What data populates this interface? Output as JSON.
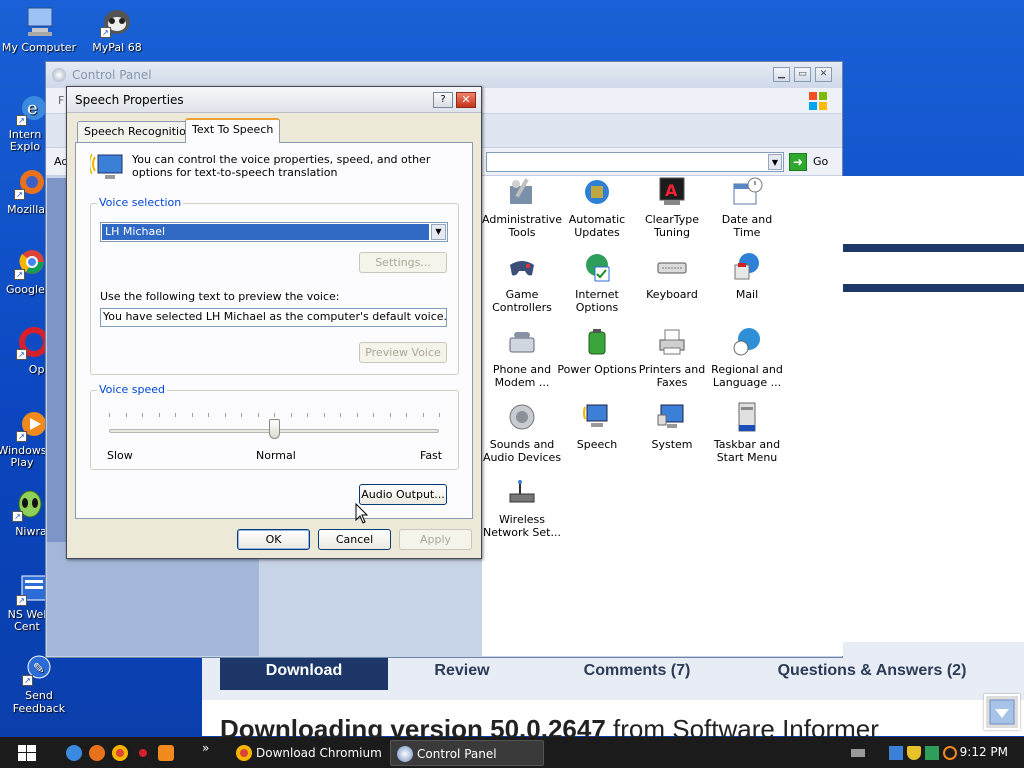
{
  "desktop": {
    "icons": [
      {
        "label": "My Computer"
      },
      {
        "label": "MyPal 68"
      },
      {
        "label": "Intern Explo"
      },
      {
        "label": "Mozilla F"
      },
      {
        "label": "Google C"
      },
      {
        "label": "Ope"
      },
      {
        "label": "Windows Play"
      },
      {
        "label": "Niwrac"
      },
      {
        "label": "NS Wel Cent"
      },
      {
        "label": "Send Feedback"
      }
    ]
  },
  "browser_page": {
    "tabs": [
      "Download",
      "Review",
      "Comments (7)",
      "Questions & Answers (2)"
    ],
    "heading_bold": "Downloading version 50.0.2647",
    "heading_rest": " from Software Informer"
  },
  "control_panel": {
    "title": "Control Panel",
    "left_letters": {
      "f": "F",
      "ad": "Ad"
    },
    "go_label": "Go",
    "items": [
      {
        "label": "Administrative Tools"
      },
      {
        "label": "Automatic Updates"
      },
      {
        "label": "ClearType Tuning"
      },
      {
        "label": "Date and Time"
      },
      {
        "label": "Game Controllers"
      },
      {
        "label": "Internet Options"
      },
      {
        "label": "Keyboard"
      },
      {
        "label": "Mail"
      },
      {
        "label": "Phone and Modem ..."
      },
      {
        "label": "Power Options"
      },
      {
        "label": "Printers and Faxes"
      },
      {
        "label": "Regional and Language ..."
      },
      {
        "label": "Sounds and Audio Devices"
      },
      {
        "label": "Speech"
      },
      {
        "label": "System"
      },
      {
        "label": "Taskbar and Start Menu"
      },
      {
        "label": "Wireless Network Set..."
      }
    ]
  },
  "dialog": {
    "title": "Speech Properties",
    "help_label": "?",
    "close_label": "✕",
    "tabs": [
      "Speech Recognition",
      "Text To Speech"
    ],
    "intro": "You can control the voice properties, speed, and other options for text-to-speech translation",
    "voice_selection": {
      "label": "Voice selection",
      "selected_voice": "LH Michael",
      "settings_button": "Settings...",
      "preview_label": "Use the following text to preview the voice:",
      "preview_text": "You have selected LH Michael as the computer's default voice.",
      "preview_button": "Preview Voice"
    },
    "voice_speed": {
      "label": "Voice speed",
      "slow": "Slow",
      "normal": "Normal",
      "fast": "Fast",
      "level": 0.5
    },
    "audio_output_button": "Audio Output...",
    "ok": "OK",
    "cancel": "Cancel",
    "apply": "Apply"
  },
  "taskbar": {
    "tasks": [
      {
        "label": "Download Chromium b..."
      },
      {
        "label": "Control Panel"
      }
    ],
    "chevron": "»",
    "clock": "9:12 PM"
  }
}
